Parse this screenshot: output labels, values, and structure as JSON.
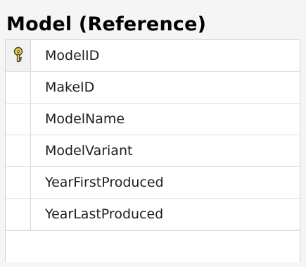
{
  "table": {
    "title": "Model (Reference)",
    "columns": [
      {
        "name": "ModelID",
        "is_primary_key": true,
        "icon": "primary-key-icon"
      },
      {
        "name": "MakeID",
        "is_primary_key": false
      },
      {
        "name": "ModelName",
        "is_primary_key": false
      },
      {
        "name": "ModelVariant",
        "is_primary_key": false
      },
      {
        "name": "YearFirstProduced",
        "is_primary_key": false
      },
      {
        "name": "YearLastProduced",
        "is_primary_key": false
      }
    ]
  },
  "colors": {
    "background": "#f5f5f5",
    "grid_background": "#ffffff",
    "grid_border": "#d0d0d0",
    "key_icon": "#d8b12c"
  }
}
